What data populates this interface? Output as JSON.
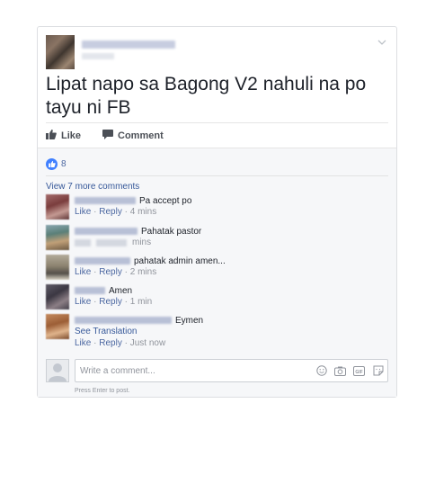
{
  "post": {
    "text": "Lipat napo sa Bagong V2 nahuli na po tayu ni FB"
  },
  "actions": {
    "like_label": "Like",
    "comment_label": "Comment"
  },
  "reactions": {
    "count": "8"
  },
  "comments_section": {
    "view_more": "View 7 more comments",
    "comments": [
      {
        "text": "Pa accept po",
        "like": "Like",
        "reply": "Reply",
        "time": "4 mins",
        "sep": "·"
      },
      {
        "text": "Pahatak pastor",
        "time": "mins"
      },
      {
        "text": "pahatak admin amen...",
        "like": "Like",
        "reply": "Reply",
        "time": "2 mins",
        "sep": "·"
      },
      {
        "text": "Amen",
        "like": "Like",
        "reply": "Reply",
        "time": "1 min",
        "sep": "·"
      },
      {
        "text": "Eymen",
        "see_translation": "See Translation",
        "like": "Like",
        "reply": "Reply",
        "time": "Just now",
        "sep": "·"
      }
    ]
  },
  "composer": {
    "placeholder": "Write a comment...",
    "hint": "Press Enter to post."
  },
  "colors": {
    "link": "#365899",
    "like_badge": "#4080ff",
    "meta": "#90949c"
  },
  "icons": [
    "chevron-down-icon",
    "thumbs-up-icon",
    "comment-bubble-icon",
    "emoji-icon",
    "camera-icon",
    "gif-icon",
    "sticker-icon"
  ]
}
